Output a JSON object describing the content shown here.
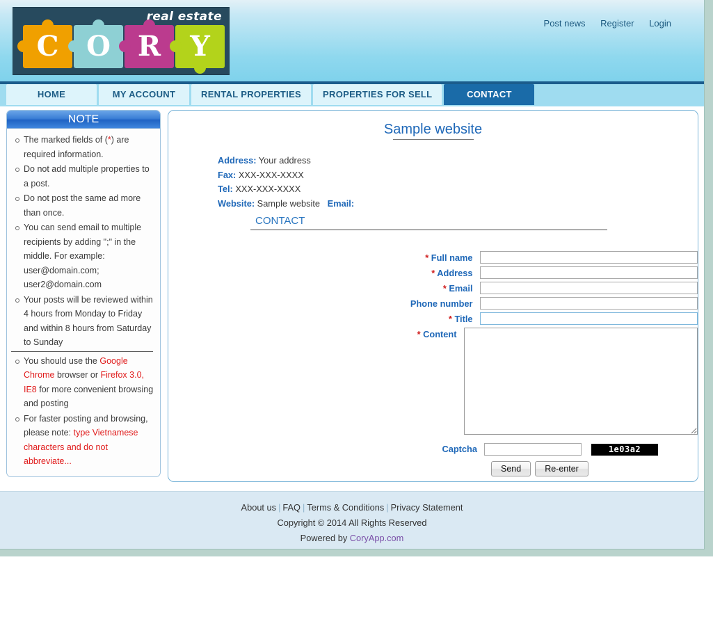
{
  "header": {
    "logo": {
      "tagline": "real estate",
      "pieces": [
        {
          "letter": "C",
          "color": "#f0a000"
        },
        {
          "letter": "O",
          "color": "#8ed0d4"
        },
        {
          "letter": "R",
          "color": "#bb3b8e"
        },
        {
          "letter": "Y",
          "color": "#b3d31b"
        }
      ]
    },
    "top_links": [
      {
        "label": "Post news"
      },
      {
        "label": "Register"
      },
      {
        "label": "Login"
      }
    ]
  },
  "nav": {
    "tabs": [
      {
        "label": "HOME",
        "active": false
      },
      {
        "label": "MY ACCOUNT",
        "active": false
      },
      {
        "label": "RENTAL PROPERTIES",
        "active": false
      },
      {
        "label": "PROPERTIES FOR SELL",
        "active": false
      },
      {
        "label": "CONTACT",
        "active": true
      }
    ]
  },
  "sidebar": {
    "title": "NOTE",
    "items": [
      "The marked fields of (*) are required information.",
      "Do not add multiple properties to a post.",
      "Do not post the same ad more than once.",
      "You can send email to multiple recipients by adding \";\" in the middle. For example: user@domain.com; user2@domain.com",
      "Your posts will be reviewed within 4 hours from Monday to Friday and within 8 hours from Saturday to Sunday",
      "You should use the Google Chrome browser or Firefox 3.0, IE8 for more convenient browsing and posting",
      "For faster posting and browsing, please note: type Vietnamese characters and do not abbreviate..."
    ],
    "item1_prefix": "The marked fields of (",
    "item1_star": "*",
    "item1_suffix": ") are required information.",
    "item6_prefix": "You should use the ",
    "item6_red1": "Google Chrome",
    "item6_mid": " browser or ",
    "item6_red2": "Firefox 3.0, IE8",
    "item6_suffix": " for more convenient browsing and posting",
    "item7_prefix": "For faster posting and browsing, please note: ",
    "item7_red": "type Vietnamese characters and do not abbreviate..."
  },
  "main": {
    "site_title": "Sample website",
    "info": {
      "address_label": "Address:",
      "address_value": "Your address",
      "fax_label": "Fax:",
      "fax_value": "XXX-XXX-XXXX",
      "tel_label": "Tel:",
      "tel_value": "XXX-XXX-XXXX",
      "website_label": "Website:",
      "website_value": "Sample website",
      "email_label": "Email:",
      "email_value": ""
    },
    "section_title": "CONTACT",
    "form": {
      "fields": [
        {
          "label": "Full name",
          "required": true,
          "value": "",
          "placeholder": "",
          "type": "text",
          "focused": false
        },
        {
          "label": "Address",
          "required": true,
          "value": "",
          "placeholder": "",
          "type": "text",
          "focused": false
        },
        {
          "label": "Email",
          "required": true,
          "value": "",
          "placeholder": "",
          "type": "text",
          "focused": false
        },
        {
          "label": "Phone number",
          "required": false,
          "value": "",
          "placeholder": "",
          "type": "text",
          "focused": false
        },
        {
          "label": "Title",
          "required": true,
          "value": "",
          "placeholder": "",
          "type": "text",
          "focused": true
        },
        {
          "label": "Content",
          "required": true,
          "value": "",
          "placeholder": "",
          "type": "textarea",
          "focused": false
        }
      ],
      "captcha_label": "Captcha",
      "captcha_value": "",
      "captcha_code": "1e03a2",
      "send_label": "Send",
      "reenter_label": "Re-enter"
    }
  },
  "footer": {
    "links": [
      "About us",
      "FAQ",
      "Terms & Conditions",
      "Privacy Statement"
    ],
    "separator": "|",
    "copyright": "Copyright © 2014 All Rights Reserved",
    "powered_prefix": "Powered by ",
    "powered_link": "CoryApp.com"
  },
  "colors": {
    "accent_blue": "#1f68b8",
    "active_tab": "#1a6ba8",
    "required_red": "#d02020",
    "note_red": "#e01b1b",
    "page_bg": "#b9d3cc"
  }
}
